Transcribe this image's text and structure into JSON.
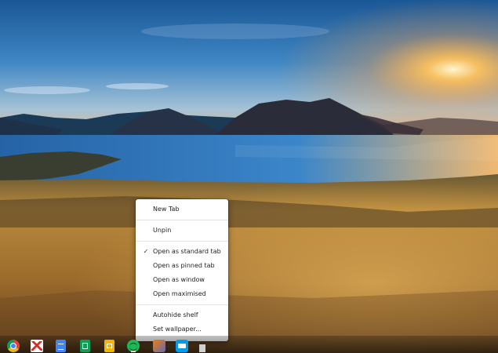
{
  "context_menu": {
    "items": [
      {
        "label": "New Tab",
        "checked": false
      },
      {
        "label": "Unpin",
        "checked": false
      },
      {
        "label": "Open as standard tab",
        "checked": true
      },
      {
        "label": "Open as pinned tab",
        "checked": false
      },
      {
        "label": "Open as window",
        "checked": false
      },
      {
        "label": "Open maximised",
        "checked": false
      },
      {
        "label": "Autohide shelf",
        "checked": false
      },
      {
        "label": "Set wallpaper...",
        "checked": false
      }
    ],
    "check_glyph": "✓"
  },
  "shelf": {
    "apps": [
      {
        "icon": "chrome-icon"
      },
      {
        "icon": "gmail-icon"
      },
      {
        "icon": "google-docs-icon"
      },
      {
        "icon": "google-sheets-icon"
      },
      {
        "icon": "google-slides-icon"
      },
      {
        "icon": "spotify-icon"
      },
      {
        "icon": "app-icon"
      },
      {
        "icon": "app-icon"
      },
      {
        "icon": "app-icon"
      }
    ]
  },
  "colors": {
    "sky_top": "#1c5d9c",
    "sun": "#ffb347",
    "lake": "#2f72b8",
    "grass": "#b07a2a"
  }
}
